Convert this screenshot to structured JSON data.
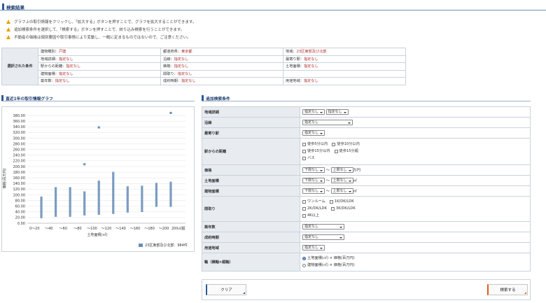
{
  "header": {
    "title": "検索結果"
  },
  "notes": [
    "グラフ上の取引情報をクリックし、「拡大する」ボタンを押すことで、グラフを拡大することができます。",
    "追加検索条件を選択して、「検索する」ボタンを押すことで、絞り込み検索を行うことができます。",
    "不動産の価格は個別要因や取引事情により変動し、一概に定まるものではないので、ご注意ください。"
  ],
  "conditions": {
    "label": "選択された条件",
    "rows": [
      [
        {
          "k": "建物種別：",
          "v": "戸建"
        },
        {
          "k": "都道府県：",
          "v": "東京都"
        },
        {
          "k": "地域：",
          "v": "23区東部及び北部"
        }
      ],
      [
        {
          "k": "地域詳細：",
          "v": "指定なし"
        },
        {
          "k": "沿線：",
          "v": "指定なし"
        },
        {
          "k": "最寄り駅：",
          "v": "指定なし"
        }
      ],
      [
        {
          "k": "駅からの距離：",
          "v": "指定なし"
        },
        {
          "k": "価格：",
          "v": "指定なし"
        },
        {
          "k": "土地面積：",
          "v": "指定なし"
        }
      ],
      [
        {
          "k": "建物面積：",
          "v": "指定なし"
        },
        {
          "k": "間取り：",
          "v": "指定なし"
        },
        {
          "k": "",
          "v": ""
        }
      ],
      [
        {
          "k": "築年数：",
          "v": "指定なし"
        },
        {
          "k": "成約時期：",
          "v": "指定なし"
        },
        {
          "k": "用途地域：",
          "v": "指定なし"
        }
      ]
    ]
  },
  "chart_section": {
    "title": "直近1年の取引情報グラフ"
  },
  "chart_data": {
    "type": "scatter",
    "ylabel": "価格(百万円)",
    "xlabel": "土地面積(㎡)",
    "categories": [
      "0～20",
      "～40",
      "～60",
      "～80",
      "～100",
      "～120",
      "～140",
      "～160",
      "～180",
      "～200",
      "200㎡超"
    ],
    "ylim": [
      0,
      390
    ],
    "yticks": [
      "0.00",
      "20.00",
      "40.00",
      "60.00",
      "80.00",
      "100.00",
      "120.00",
      "140.00",
      "160.00",
      "180.00",
      "200.00",
      "220.00",
      "240.00",
      "260.00",
      "280.00",
      "300.00",
      "320.00",
      "340.00",
      "360.00",
      "380.00"
    ],
    "series": [
      {
        "name": "23区東部及び北部：984件",
        "columns": [
          {
            "x": 1,
            "min": 20,
            "max": 95,
            "outliers": []
          },
          {
            "x": 2,
            "min": 25,
            "max": 125,
            "outliers": []
          },
          {
            "x": 3,
            "min": 25,
            "max": 128,
            "outliers": []
          },
          {
            "x": 4,
            "min": 30,
            "max": 112,
            "outliers": [
              208
            ]
          },
          {
            "x": 5,
            "min": 32,
            "max": 150,
            "outliers": [
              338
            ]
          },
          {
            "x": 6,
            "min": 35,
            "max": 180,
            "outliers": []
          },
          {
            "x": 7,
            "min": 40,
            "max": 128,
            "outliers": []
          },
          {
            "x": 8,
            "min": 42,
            "max": 132,
            "outliers": []
          },
          {
            "x": 9,
            "min": 60,
            "max": 140,
            "outliers": []
          },
          {
            "x": 10,
            "min": 60,
            "max": 145,
            "outliers": [
              389
            ]
          }
        ]
      }
    ],
    "legend": "bottom-right",
    "color": "#6b8fb8"
  },
  "form_section": {
    "title": "追加検索条件"
  },
  "form": {
    "area_detail": {
      "label": "地域詳細",
      "sel1": "指定なし",
      "sel2": "指定なし"
    },
    "line": {
      "label": "沿線",
      "sel": "指定なし"
    },
    "station": {
      "label": "最寄り駅",
      "sel": "指定なし"
    },
    "distance": {
      "label": "駅からの距離",
      "opts": [
        "徒歩5分以内",
        "徒歩10分以内",
        "徒歩15分以内",
        "徒歩15分超",
        "バス"
      ]
    },
    "price": {
      "label": "価格",
      "low": "下限なし",
      "high": "上限なし",
      "tilde": "～",
      "unit": "万円"
    },
    "land": {
      "label": "土地面積",
      "low": "下限なし",
      "high": "上限なし",
      "tilde": "～",
      "unit": "㎡"
    },
    "building": {
      "label": "建物面積",
      "low": "下限なし",
      "high": "上限なし",
      "tilde": "～",
      "unit": "㎡"
    },
    "layout": {
      "label": "間取り",
      "opts": [
        "ワンルーム",
        "1K/DK/LDK",
        "2K/DK/LDK",
        "3K/DK/LDK",
        "4K以上"
      ]
    },
    "age": {
      "label": "築年数",
      "sel": "指定なし"
    },
    "period": {
      "label": "成約時期",
      "sel": "指定なし"
    },
    "zoning": {
      "label": "用途地域",
      "sel": "指定なし"
    },
    "axis": {
      "label": "軸（横軸×縦軸）",
      "opt1": "土地面積(㎡) × 価格(百万円)",
      "opt2": "建物面積(㎡) × 価格(百万円)"
    }
  },
  "buttons": {
    "clear": "クリア",
    "search": "検索する"
  }
}
